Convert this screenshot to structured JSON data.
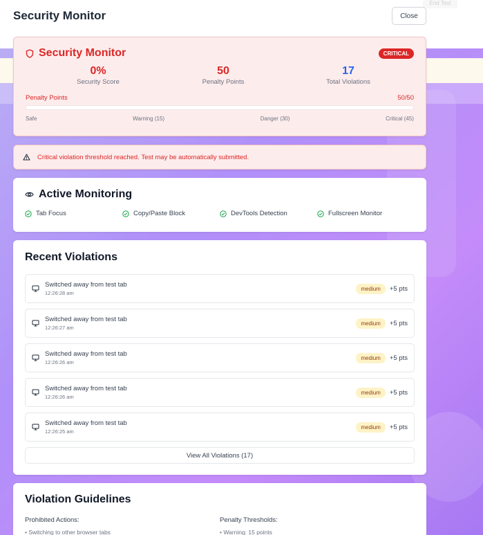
{
  "header": {
    "title": "Security Monitor",
    "close_label": "Close"
  },
  "background": {
    "button_label": "End Test"
  },
  "score_card": {
    "title": "Security Monitor",
    "badge": "CRITICAL",
    "stats": [
      {
        "value": "0%",
        "label": "Security Score",
        "color": "#dc2626"
      },
      {
        "value": "50",
        "label": "Penalty Points",
        "color": "#dc2626"
      },
      {
        "value": "17",
        "label": "Total Violations",
        "color": "#2563eb"
      }
    ],
    "penalty_label": "Penalty Points",
    "penalty_value": "50/50",
    "scale": [
      "Safe",
      "Warning (15)",
      "Danger (30)",
      "Critical (45)"
    ]
  },
  "alert": {
    "text": "Critical violation threshold reached. Test may be automatically submitted."
  },
  "monitoring": {
    "title": "Active Monitoring",
    "items": [
      "Tab Focus",
      "Copy/Paste Block",
      "DevTools Detection",
      "Fullscreen Monitor"
    ]
  },
  "violations": {
    "title": "Recent Violations",
    "items": [
      {
        "desc": "Switched away from test tab",
        "time": "12:26:28 am",
        "severity": "medium",
        "points": "+5 pts"
      },
      {
        "desc": "Switched away from test tab",
        "time": "12:26:27 am",
        "severity": "medium",
        "points": "+5 pts"
      },
      {
        "desc": "Switched away from test tab",
        "time": "12:26:26 am",
        "severity": "medium",
        "points": "+5 pts"
      },
      {
        "desc": "Switched away from test tab",
        "time": "12:26:26 am",
        "severity": "medium",
        "points": "+5 pts"
      },
      {
        "desc": "Switched away from test tab",
        "time": "12:26:25 am",
        "severity": "medium",
        "points": "+5 pts"
      }
    ],
    "view_all": "View All Violations (17)"
  },
  "guidelines": {
    "title": "Violation Guidelines",
    "prohibited_head": "Prohibited Actions:",
    "prohibited_first": "• Switching to other browser tabs",
    "thresholds_head": "Penalty Thresholds:",
    "thresholds_first": "• Warning: 15 points"
  },
  "colors": {
    "danger": "#dc2626",
    "info": "#2563eb",
    "success": "#16a34a"
  }
}
